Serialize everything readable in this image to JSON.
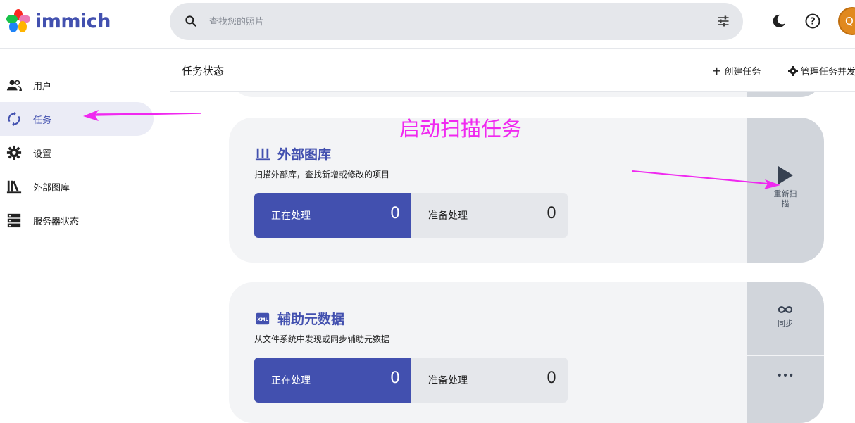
{
  "brand": {
    "name": "immich"
  },
  "search": {
    "placeholder": "查找您的照片"
  },
  "avatar": {
    "initial": "Q"
  },
  "sidebar": {
    "items": [
      {
        "label": "用户",
        "icon": "users-icon"
      },
      {
        "label": "任务",
        "icon": "sync-icon",
        "active": true
      },
      {
        "label": "设置",
        "icon": "gear-icon"
      },
      {
        "label": "外部图库",
        "icon": "library-icon"
      },
      {
        "label": "服务器状态",
        "icon": "server-icon"
      }
    ]
  },
  "subheader": {
    "title": "任务状态",
    "create_job": "创建任务",
    "manage_concurrency": "管理任务并发"
  },
  "annotation": {
    "text": "启动扫描任务"
  },
  "jobs": [
    {
      "title": "外部图库",
      "description": "扫描外部库，查找新增或修改的项目",
      "active_label": "正在处理",
      "active_count": "0",
      "waiting_label": "准备处理",
      "waiting_count": "0",
      "action_label": "重新扫描"
    },
    {
      "title": "辅助元数据",
      "description": "从文件系统中发现或同步辅助元数据",
      "active_label": "正在处理",
      "active_count": "0",
      "waiting_label": "准备处理",
      "waiting_count": "0",
      "action_label": "同步"
    }
  ],
  "colors": {
    "accent": "#4250af",
    "annotation": "#f028f0"
  }
}
